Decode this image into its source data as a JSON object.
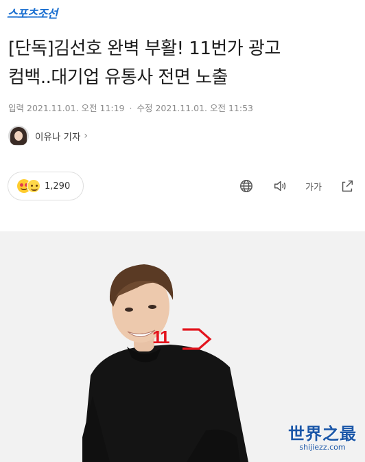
{
  "header": {
    "logo": "스포츠조선"
  },
  "article": {
    "headline_line1": "[단독]김선호 완벽 부활! 11번가 광고",
    "headline_line2": "컴백..대기업 유통사 전면 노출",
    "published_label": "입력",
    "published_time": "2021.11.01. 오전 11:19",
    "modified_label": "수정",
    "modified_time": "2021.11.01. 오전 11:53"
  },
  "reporter": {
    "name": "이유나 기자",
    "chevron": "›"
  },
  "reactions": {
    "count": "1,290"
  },
  "toolbar": {
    "icons": [
      "globe-icon",
      "speaker-icon",
      "font-size-icon",
      "share-icon"
    ],
    "font_size_label": "가가"
  },
  "photo": {
    "brand_text": "11"
  },
  "watermark": {
    "title": "世界之最",
    "url": "shijiezz.com"
  },
  "colors": {
    "logo_blue": "#1a6fd0",
    "brand_red": "#e3141d",
    "watermark_blue": "#1b57a8"
  }
}
